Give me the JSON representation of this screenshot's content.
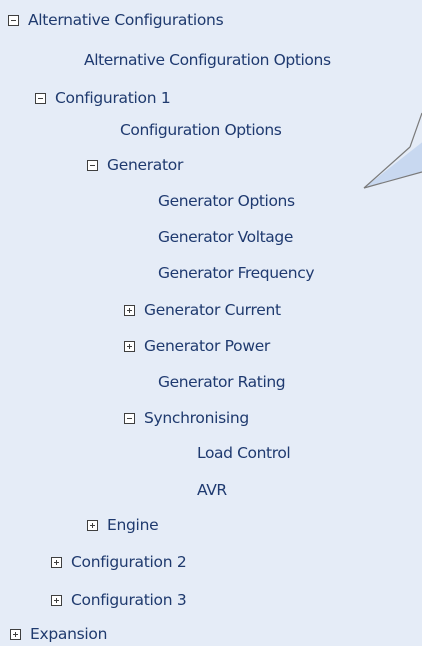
{
  "tree": {
    "alternative_configurations": "Alternative Configurations",
    "alternative_configuration_options": "Alternative Configuration Options",
    "configuration_1": "Configuration 1",
    "configuration_options": "Configuration Options",
    "generator": "Generator",
    "generator_options": "Generator Options",
    "generator_voltage": "Generator Voltage",
    "generator_frequency": "Generator Frequency",
    "generator_current": "Generator Current",
    "generator_power": "Generator Power",
    "generator_rating": "Generator Rating",
    "synchronising": "Synchronising",
    "load_control": "Load Control",
    "avr": "AVR",
    "engine": "Engine",
    "configuration_2": "Configuration 2",
    "configuration_3": "Configuration 3",
    "expansion": "Expansion"
  },
  "colors": {
    "panel_background": "#e5ecf7",
    "label_text": "#1f3a6e",
    "callout_fill": "#c8d8f0"
  }
}
